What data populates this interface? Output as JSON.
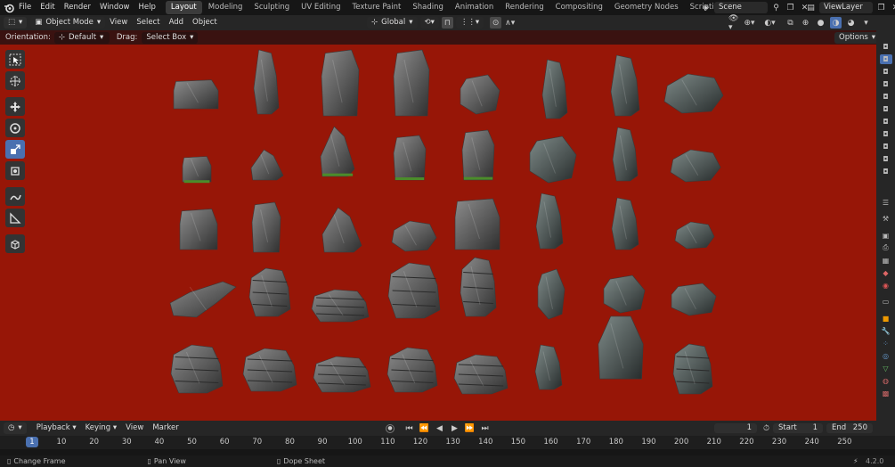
{
  "menu": [
    "File",
    "Edit",
    "Render",
    "Window",
    "Help"
  ],
  "workspaces": [
    "Layout",
    "Modeling",
    "Sculpting",
    "UV Editing",
    "Texture Paint",
    "Shading",
    "Animation",
    "Rendering",
    "Compositing",
    "Geometry Nodes",
    "Scripting"
  ],
  "add_workspace": "+",
  "scene": "Scene",
  "view_layer": "ViewLayer",
  "header": {
    "mode": "Object Mode",
    "view": "View",
    "select": "Select",
    "add": "Add",
    "object": "Object",
    "transform": "Global"
  },
  "tool_settings": {
    "orientation_label": "Orientation:",
    "orientation": "Default",
    "drag_label": "Drag:",
    "drag": "Select Box",
    "options": "Options"
  },
  "timeline": {
    "playback": "Playback",
    "keying": "Keying",
    "view": "View",
    "marker": "Marker",
    "current": "1",
    "start_label": "Start",
    "start": "1",
    "end_label": "End",
    "end": "250",
    "current_marker": "1",
    "ticks": [
      "10",
      "20",
      "30",
      "40",
      "50",
      "60",
      "70",
      "80",
      "90",
      "100",
      "110",
      "120",
      "130",
      "140",
      "150",
      "160",
      "170",
      "180",
      "190",
      "200",
      "210",
      "220",
      "230",
      "240",
      "250"
    ]
  },
  "status": {
    "left": "Change Frame",
    "mid": "Pan View",
    "right": "Dope Sheet",
    "version": "4.2.0"
  },
  "colors": {
    "viewport_bg": "#971607",
    "accent": "#4a70b0"
  }
}
